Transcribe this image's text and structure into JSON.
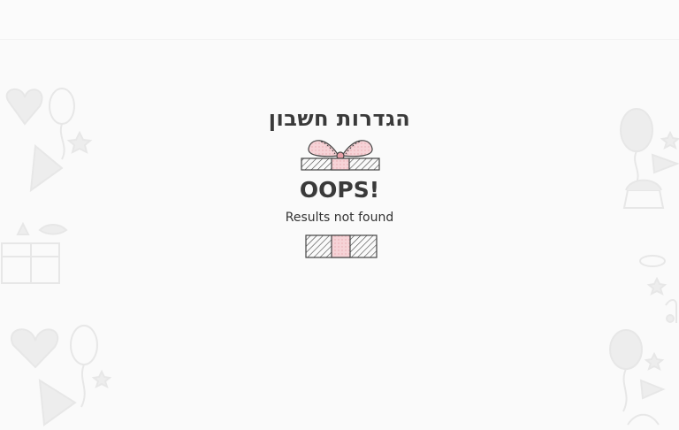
{
  "header": {
    "title": "הגדרות חשבון"
  },
  "empty_state": {
    "heading": "OOPS!",
    "message": "Results not found",
    "illustration_icon": "gift-box-icon"
  },
  "colors": {
    "background": "#fafafa",
    "text": "#3a3a3a",
    "ribbon_pink": "#f4c6cb",
    "decoration": "#e6e6e6"
  }
}
